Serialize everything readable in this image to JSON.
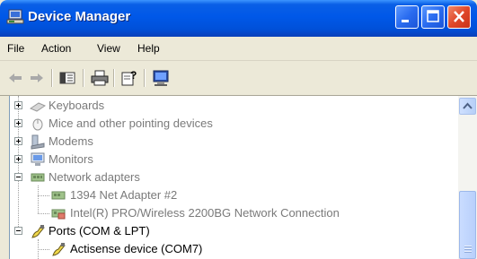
{
  "window": {
    "title": "Device Manager"
  },
  "menu": {
    "file": "File",
    "action": "Action",
    "view": "View",
    "help": "Help"
  },
  "toolbar": {
    "icons": [
      "back-arrow-icon",
      "forward-arrow-icon",
      "show-hide-tree-icon",
      "print-icon",
      "properties-help-icon",
      "scan-hardware-icon"
    ]
  },
  "tree": {
    "keyboards": "Keyboards",
    "mice": "Mice and other pointing devices",
    "modems": "Modems",
    "monitors": "Monitors",
    "network_adapters": "Network adapters",
    "net_adapter_1394": "1394 Net Adapter #2",
    "intel_wireless": "Intel(R) PRO/Wireless 2200BG Network Connection",
    "ports": "Ports (COM & LPT)",
    "actisense": "Actisense device (COM7)"
  },
  "colors": {
    "titlebar": "#0058e8",
    "close_button": "#e0482a",
    "dimmed_text": "#7a7a7a"
  }
}
